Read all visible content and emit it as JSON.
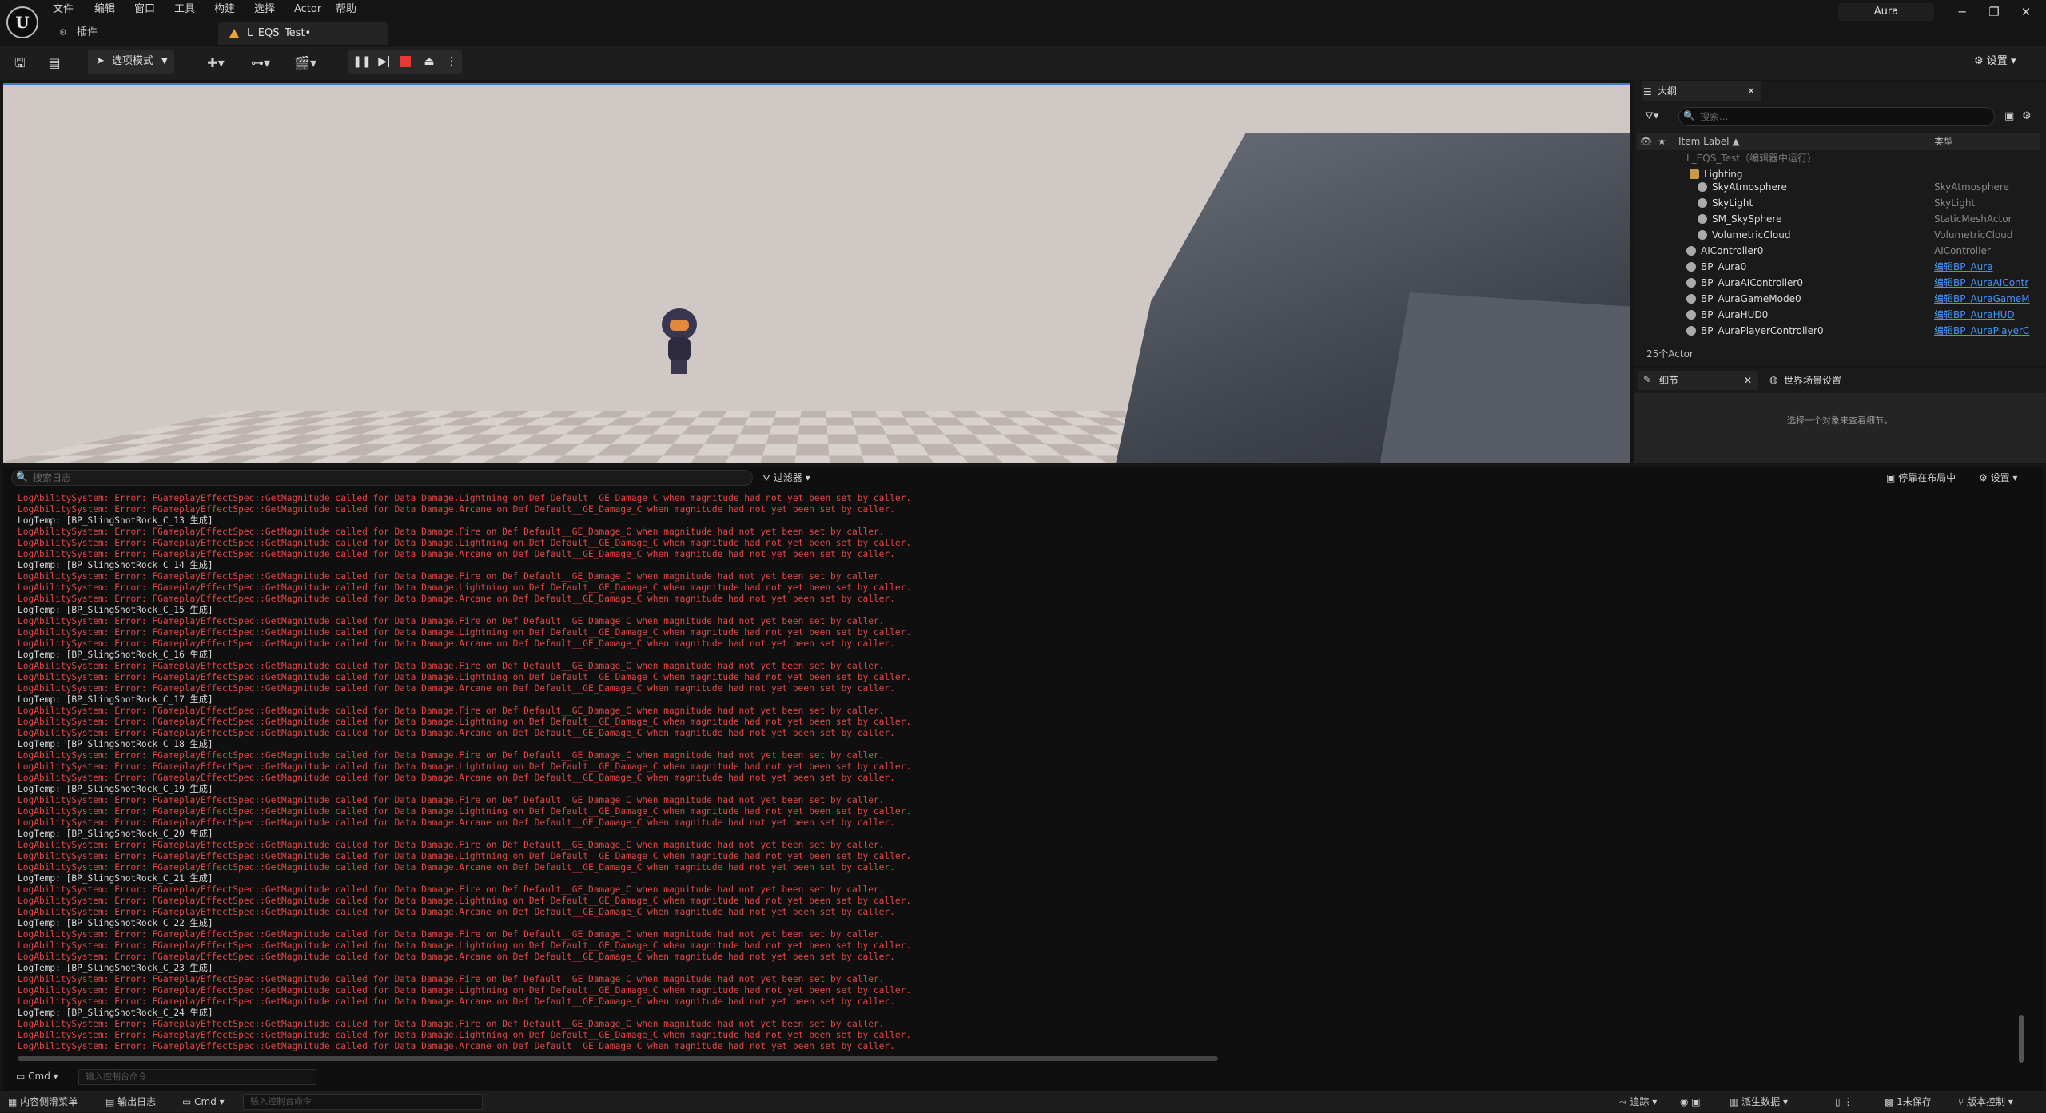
{
  "menu": [
    "文件",
    "编辑",
    "窗口",
    "工具",
    "构建",
    "选择",
    "Actor",
    "帮助"
  ],
  "tabs": {
    "plugins": "插件",
    "level": "L_EQS_Test•"
  },
  "user": "Aura",
  "toolbar": {
    "mode": "选项模式",
    "settings": "设置"
  },
  "outliner": {
    "title": "大纲",
    "search_placeholder": "搜索...",
    "col_label": "Item Label ▲",
    "col_type": "类型",
    "rows": [
      {
        "label": "L_EQS_Test（编辑器中运行）",
        "type": "",
        "link": false,
        "dim": true
      },
      {
        "label": "Lighting",
        "type": "",
        "link": false,
        "dim": false
      },
      {
        "label": "SkyAtmosphere",
        "type": "SkyAtmosphere",
        "link": false,
        "dim": false
      },
      {
        "label": "SkyLight",
        "type": "SkyLight",
        "link": false,
        "dim": false
      },
      {
        "label": "SM_SkySphere",
        "type": "StaticMeshActor",
        "link": false,
        "dim": false
      },
      {
        "label": "VolumetricCloud",
        "type": "VolumetricCloud",
        "link": false,
        "dim": false
      },
      {
        "label": "AIController0",
        "type": "AIController",
        "link": false,
        "dim": false
      },
      {
        "label": "BP_Aura0",
        "type": "编辑BP_Aura",
        "link": true,
        "dim": false
      },
      {
        "label": "BP_AuraAIController0",
        "type": "编辑BP_AuraAIContr",
        "link": true,
        "dim": false
      },
      {
        "label": "BP_AuraGameMode0",
        "type": "编辑BP_AuraGameM",
        "link": true,
        "dim": false
      },
      {
        "label": "BP_AuraHUD0",
        "type": "编辑BP_AuraHUD",
        "link": true,
        "dim": false
      },
      {
        "label": "BP_AuraPlayerController0",
        "type": "编辑BP_AuraPlayerC",
        "link": true,
        "dim": false
      }
    ],
    "count": "25个Actor"
  },
  "details": {
    "tab1": "细节",
    "tab2": "世界场景设置",
    "hint": "选择一个对象来查看细节。"
  },
  "log": {
    "search_placeholder": "搜索日志",
    "filter": "过滤器",
    "dock": "停靠在布局中",
    "settings": "设置",
    "err_fire": "LogAbilitySystem: Error: FGameplayEffectSpec::GetMagnitude called for Data Damage.Fire on Def Default__GE_Damage_C when magnitude had not yet been set by caller.",
    "err_lightning": "LogAbilitySystem: Error: FGameplayEffectSpec::GetMagnitude called for Data Damage.Lightning on Def Default__GE_Damage_C when magnitude had not yet been set by caller.",
    "err_arcane": "LogAbilitySystem: Error: FGameplayEffectSpec::GetMagnitude called for Data Damage.Arcane on Def Default__GE_Damage_C when magnitude had not yet been set by caller.",
    "temp_lines": [
      "LogTemp: [BP_SlingShotRock_C_13 生成]",
      "LogTemp: [BP_SlingShotRock_C_14 生成]",
      "LogTemp: [BP_SlingShotRock_C_15 生成]",
      "LogTemp: [BP_SlingShotRock_C_16 生成]",
      "LogTemp: [BP_SlingShotRock_C_17 生成]",
      "LogTemp: [BP_SlingShotRock_C_18 生成]",
      "LogTemp: [BP_SlingShotRock_C_19 生成]",
      "LogTemp: [BP_SlingShotRock_C_20 生成]",
      "LogTemp: [BP_SlingShotRock_C_21 生成]",
      "LogTemp: [BP_SlingShotRock_C_22 生成]",
      "LogTemp: [BP_SlingShotRock_C_23 生成]",
      "LogTemp: [BP_SlingShotRock_C_24 生成]"
    ],
    "cmd": "Cmd",
    "cmd_placeholder": "输入控制台命令"
  },
  "status": {
    "content": "内容侧滑菜单",
    "output": "输出日志",
    "cmd": "Cmd",
    "cmd_placeholder": "输入控制台命令",
    "trace": "追踪",
    "derived": "派生数据",
    "unsaved": "1未保存",
    "source": "版本控制"
  }
}
